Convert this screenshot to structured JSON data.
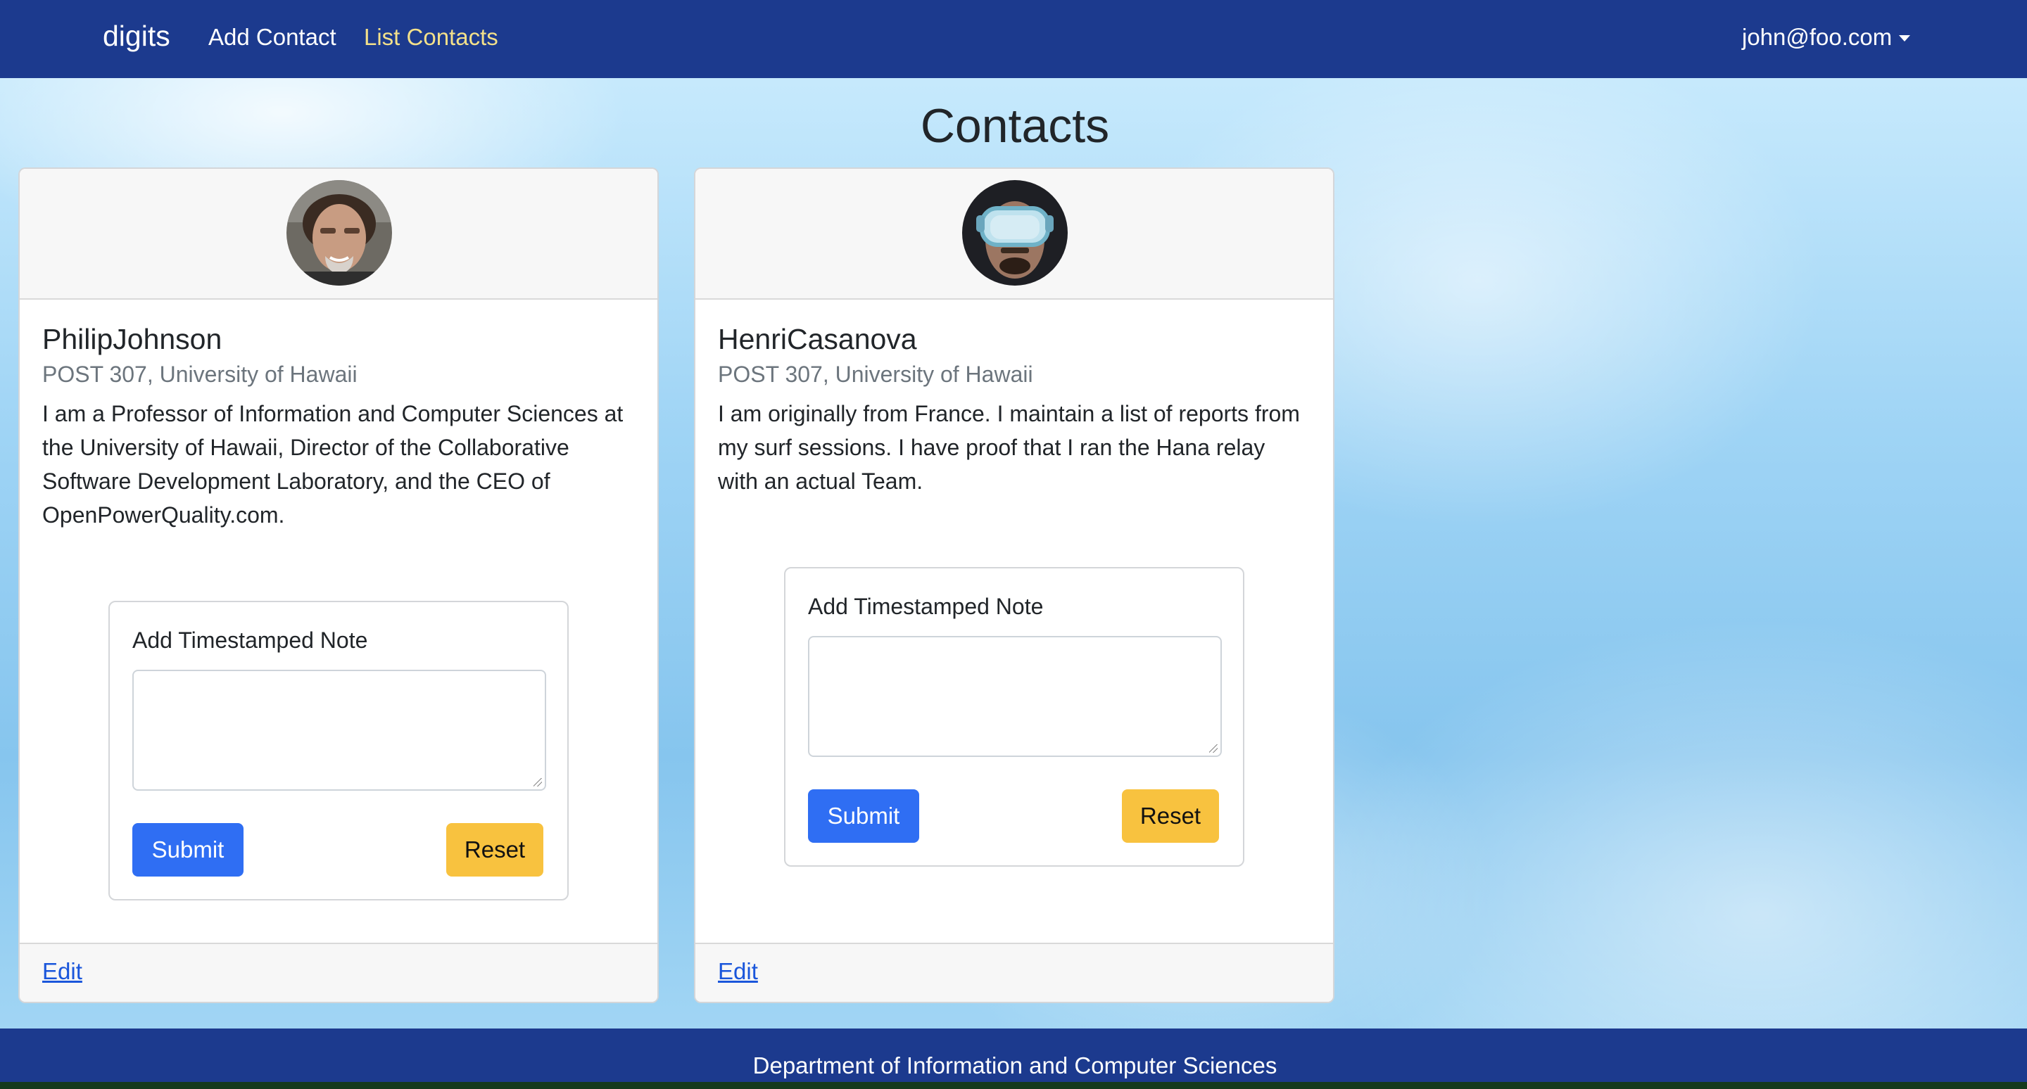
{
  "navbar": {
    "brand": "digits",
    "links": [
      "Add Contact",
      "List Contacts"
    ],
    "user": "john@foo.com"
  },
  "page": {
    "title": "Contacts"
  },
  "contacts": [
    {
      "name": "PhilipJohnson",
      "address": "POST 307, University of Hawaii",
      "description": "I am a Professor of Information and Computer Sciences at the University of Hawaii, Director of the Collaborative Software Development Laboratory, and the CEO of OpenPowerQuality.com.",
      "note_label": "Add Timestamped Note",
      "note_value": "",
      "submit_label": "Submit",
      "reset_label": "Reset",
      "edit_label": "Edit"
    },
    {
      "name": "HenriCasanova",
      "address": "POST 307, University of Hawaii",
      "description": "I am originally from France. I maintain a list of reports from my surf sessions. I have proof that I ran the Hana relay with an actual Team.",
      "note_label": "Add Timestamped Note",
      "note_value": "",
      "submit_label": "Submit",
      "reset_label": "Reset",
      "edit_label": "Edit"
    }
  ],
  "footer": {
    "text": "Department of Information and Computer Sciences"
  },
  "colors": {
    "navbar": "#1c3a8e",
    "submit": "#2f6ef3",
    "reset": "#f8c23f",
    "active_link": "#f3e08a"
  }
}
